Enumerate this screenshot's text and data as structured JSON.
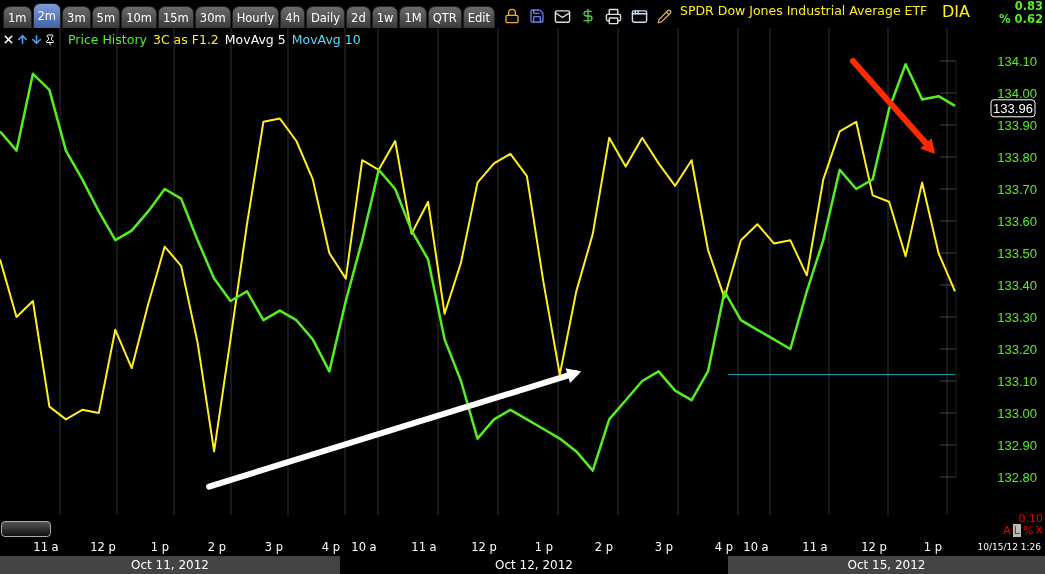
{
  "toolbar": {
    "tabs": [
      {
        "label": "1m",
        "selected": false
      },
      {
        "label": "2m",
        "selected": true
      },
      {
        "label": "3m",
        "selected": false
      },
      {
        "label": "5m",
        "selected": false
      },
      {
        "label": "10m",
        "selected": false
      },
      {
        "label": "15m",
        "selected": false
      },
      {
        "label": "30m",
        "selected": false
      },
      {
        "label": "Hourly",
        "selected": false
      },
      {
        "label": "4h",
        "selected": false
      },
      {
        "label": "Daily",
        "selected": false
      },
      {
        "label": "2d",
        "selected": false
      },
      {
        "label": "1w",
        "selected": false
      },
      {
        "label": "1M",
        "selected": false
      },
      {
        "label": "QTR",
        "selected": false
      },
      {
        "label": "Edit",
        "selected": false
      }
    ],
    "title": "SPDR Dow Jones Industrial Average ETF",
    "symbol": "DIA",
    "change": "0.83",
    "change_percent": "% 0.62"
  },
  "legend": [
    {
      "label": "MovAvg 5",
      "color": "#ffffff"
    },
    {
      "label": "MovAvg 10",
      "color": "#55ddff"
    }
  ],
  "chart": {
    "chart_data": {
      "type": "line",
      "grid": true,
      "ylim": [
        132.8,
        134.1
      ],
      "yticks": [
        {
          "value": 132.8,
          "label": "132.80"
        },
        {
          "value": 132.9,
          "label": "132.90"
        },
        {
          "value": 133.0,
          "label": "133.00"
        },
        {
          "value": 133.1,
          "label": "133.10"
        },
        {
          "value": 133.2,
          "label": "133.20"
        },
        {
          "value": 133.3,
          "label": "133.30"
        },
        {
          "value": 133.4,
          "label": "133.40"
        },
        {
          "value": 133.5,
          "label": "133.50"
        },
        {
          "value": 133.6,
          "label": "133.60"
        },
        {
          "value": 133.7,
          "label": "133.70"
        },
        {
          "value": 133.8,
          "label": "133.80"
        },
        {
          "value": 133.9,
          "label": "133.90"
        },
        {
          "value": 134.0,
          "label": "134.00"
        },
        {
          "value": 134.1,
          "label": "134.10"
        }
      ],
      "series": [
        {
          "name": "Price History",
          "color": "#55ee22",
          "values": [
            133.88,
            133.82,
            134.06,
            134.01,
            133.82,
            133.73,
            133.63,
            133.54,
            133.57,
            133.63,
            133.7,
            133.67,
            133.54,
            133.42,
            133.35,
            133.38,
            133.29,
            133.32,
            133.29,
            133.23,
            133.13,
            133.35,
            133.54,
            133.76,
            133.7,
            133.57,
            133.48,
            133.23,
            133.1,
            132.92,
            132.98,
            133.01,
            132.98,
            132.95,
            132.92,
            132.88,
            132.82,
            132.98,
            133.04,
            133.1,
            133.13,
            133.07,
            133.04,
            133.13,
            133.38,
            133.29,
            133.26,
            133.23,
            133.2,
            133.38,
            133.54,
            133.76,
            133.7,
            133.73,
            133.95,
            134.09,
            133.98,
            133.99,
            133.96
          ]
        },
        {
          "name": "3C as F1.2",
          "color": "#ffee22",
          "values": [
            133.48,
            133.3,
            133.35,
            133.02,
            132.98,
            133.01,
            133.0,
            133.26,
            133.14,
            133.34,
            133.52,
            133.46,
            133.22,
            132.88,
            133.23,
            133.59,
            133.91,
            133.92,
            133.85,
            133.73,
            133.5,
            133.42,
            133.79,
            133.76,
            133.85,
            133.56,
            133.66,
            133.31,
            133.47,
            133.72,
            133.78,
            133.81,
            133.74,
            133.41,
            133.12,
            133.38,
            133.56,
            133.86,
            133.77,
            133.86,
            133.78,
            133.71,
            133.79,
            133.51,
            133.36,
            133.54,
            133.59,
            133.53,
            133.54,
            133.43,
            133.73,
            133.88,
            133.91,
            133.68,
            133.66,
            133.49,
            133.72,
            133.5,
            133.38
          ]
        }
      ]
    },
    "last_price": "133.96"
  },
  "time_axis": {
    "days": [
      {
        "date": "Oct 11, 2012",
        "hours": [
          "11 a",
          "12 p",
          "1 p",
          "2 p",
          "3 p",
          "4 p"
        ]
      },
      {
        "date": "Oct 12, 2012",
        "hours": [
          "10 a",
          "11 a",
          "12 p",
          "1 p",
          "2 p",
          "3 p",
          "4 p"
        ]
      },
      {
        "date": "Oct 15, 2012",
        "hours": [
          "10 a",
          "11 a",
          "12 p",
          "1 p"
        ]
      }
    ],
    "scale_value": "0.10",
    "scale_buttons": [
      "A",
      "L",
      "%",
      "X"
    ],
    "timestamp": "10/15/12 1:26"
  }
}
